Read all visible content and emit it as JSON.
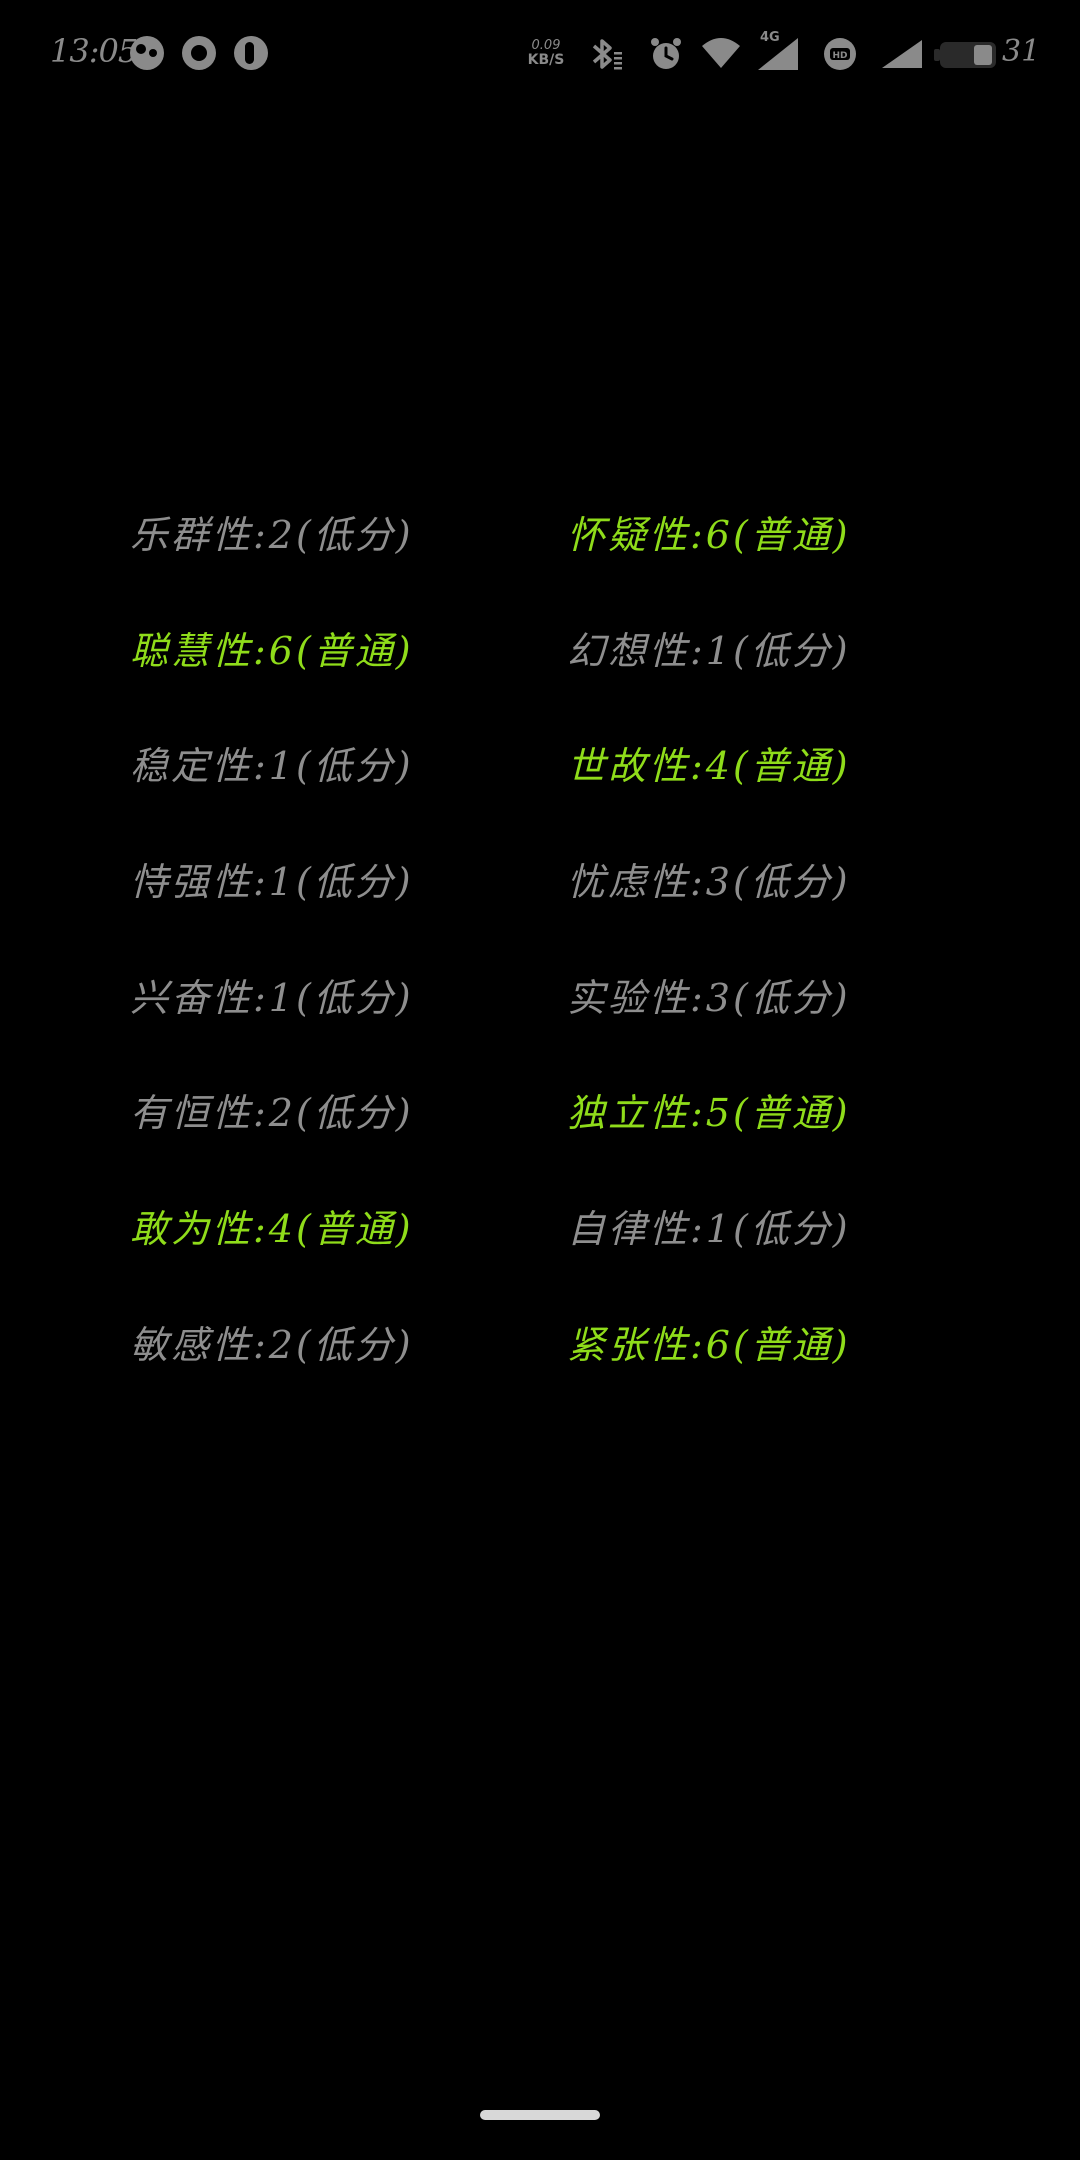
{
  "status_bar": {
    "time": "13:05",
    "net_speed_value": "0.09",
    "net_speed_unit": "KB/S",
    "network_type": "4G",
    "battery": "31"
  },
  "icons": {
    "app_1": "wechat-icon",
    "app_2": "flower-icon",
    "app_3": "music-icon",
    "bluetooth": "bluetooth-icon",
    "alarm": "alarm-icon",
    "wifi": "wifi-icon",
    "signal": "signal-icon",
    "hd": "hd-voice-icon",
    "battery": "battery-icon"
  },
  "colors": {
    "low": "#8e8e8e",
    "normal": "#8fdc1a",
    "background": "#000000"
  },
  "traits": [
    {
      "text": "乐群性:2(低分)",
      "level": "low"
    },
    {
      "text": "怀疑性:6(普通)",
      "level": "normal"
    },
    {
      "text": "聪慧性:6(普通)",
      "level": "normal"
    },
    {
      "text": "幻想性:1(低分)",
      "level": "low"
    },
    {
      "text": "稳定性:1(低分)",
      "level": "low"
    },
    {
      "text": "世故性:4(普通)",
      "level": "normal"
    },
    {
      "text": "恃强性:1(低分)",
      "level": "low"
    },
    {
      "text": "忧虑性:3(低分)",
      "level": "low"
    },
    {
      "text": "兴奋性:1(低分)",
      "level": "low"
    },
    {
      "text": "实验性:3(低分)",
      "level": "low"
    },
    {
      "text": "有恒性:2(低分)",
      "level": "low"
    },
    {
      "text": "独立性:5(普通)",
      "level": "normal"
    },
    {
      "text": "敢为性:4(普通)",
      "level": "normal"
    },
    {
      "text": "自律性:1(低分)",
      "level": "low"
    },
    {
      "text": "敏感性:2(低分)",
      "level": "low"
    },
    {
      "text": "紧张性:6(普通)",
      "level": "normal"
    }
  ]
}
